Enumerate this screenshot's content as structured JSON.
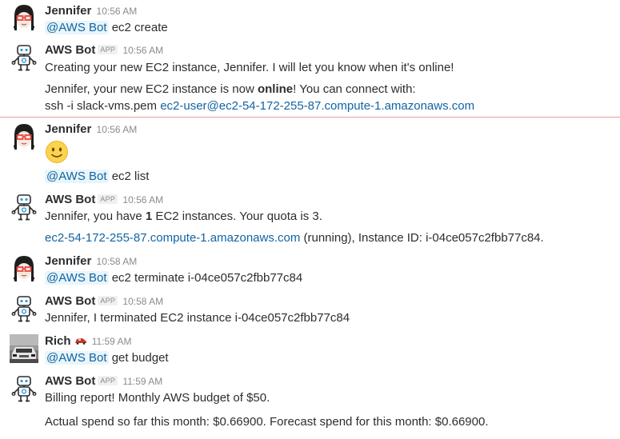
{
  "messages": [
    {
      "sender": "Jennifer",
      "time": "10:56 AM",
      "mention": "@AWS Bot",
      "text": "ec2 create"
    },
    {
      "sender": "AWS Bot",
      "badge": "APP",
      "time": "10:56 AM",
      "line1": "Creating your new EC2 instance, Jennifer. I will let you know when it's online!",
      "line2_pre": "Jennifer, your new EC2 instance is now ",
      "line2_bold": "online",
      "line2_post": "! You can connect with:",
      "line3_pre": "ssh -i slack-vms.pem ",
      "line3_link": "ec2-user@ec2-54-172-255-87.compute-1.amazonaws.com"
    },
    {
      "sender": "Jennifer",
      "time": "10:56 AM",
      "mention": "@AWS Bot",
      "text": "ec2 list"
    },
    {
      "sender": "AWS Bot",
      "badge": "APP",
      "time": "10:56 AM",
      "line1_pre": "Jennifer, you have ",
      "line1_bold": "1",
      "line1_post": " EC2 instances. Your quota is 3.",
      "line2_link": "ec2-54-172-255-87.compute-1.amazonaws.com",
      "line2_post": " (running), Instance ID: i-04ce057c2fbb77c84."
    },
    {
      "sender": "Jennifer",
      "time": "10:58 AM",
      "mention": "@AWS Bot",
      "text": "ec2 terminate i-04ce057c2fbb77c84"
    },
    {
      "sender": "AWS Bot",
      "badge": "APP",
      "time": "10:58 AM",
      "line1": "Jennifer, I terminated EC2 instance i-04ce057c2fbb77c84"
    },
    {
      "sender": "Rich",
      "time": "11:59 AM",
      "mention": "@AWS Bot",
      "text": "get budget"
    },
    {
      "sender": "AWS Bot",
      "badge": "APP",
      "time": "11:59 AM",
      "line1": "Billing report! Monthly AWS budget of $50.",
      "line2": "Actual spend so far this month: $0.66900. Forecast spend for this month: $0.66900."
    }
  ],
  "colors": {
    "link": "#1264a3",
    "mention_bg": "#e8f5fa",
    "divider": "#e7a0a0"
  },
  "icons": {
    "jennifer_avatar": "girl-with-glasses-avatar",
    "bot_avatar": "robot-avatar",
    "rich_avatar": "car-photo-avatar",
    "emoji": "slightly-smiling-face-emoji",
    "rich_status": "race-car-flag-emoji"
  }
}
